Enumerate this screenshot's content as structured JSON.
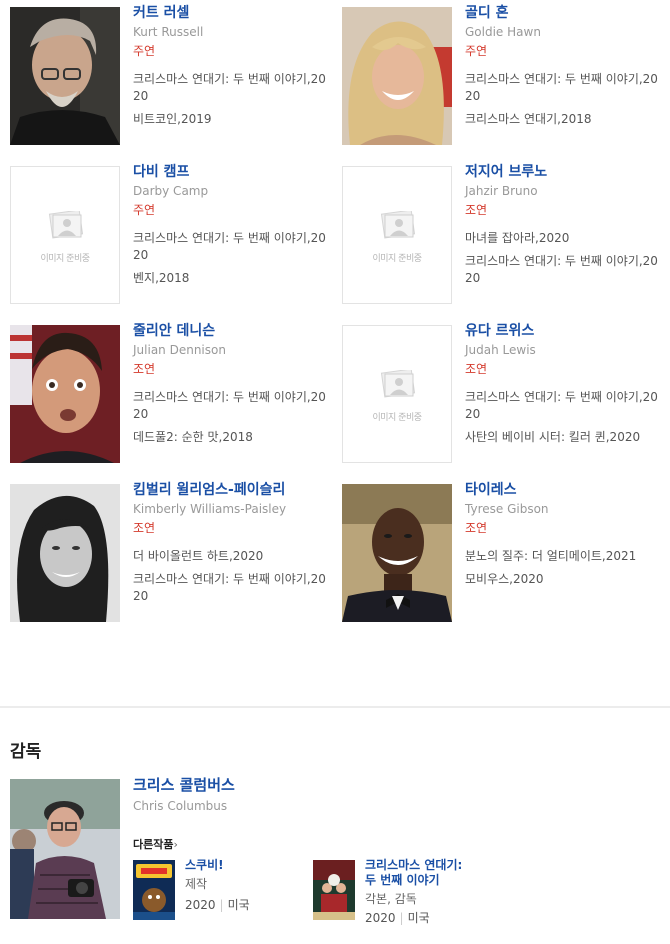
{
  "cast": [
    {
      "name_ko": "커트 러셀",
      "name_en": "Kurt Russell",
      "role": "주연",
      "works": [
        "크리스마스 연대기: 두 번째 이야기,2020",
        "비트코인,2019"
      ],
      "has_photo": true,
      "photo_icon": "portrait-photo"
    },
    {
      "name_ko": "골디 혼",
      "name_en": "Goldie Hawn",
      "role": "주연",
      "works": [
        "크리스마스 연대기: 두 번째 이야기,2020",
        "크리스마스 연대기,2018"
      ],
      "has_photo": true,
      "photo_icon": "portrait-photo"
    },
    {
      "name_ko": "다비 캠프",
      "name_en": "Darby Camp",
      "role": "주연",
      "works": [
        "크리스마스 연대기: 두 번째 이야기,2020",
        "벤지,2018"
      ],
      "has_photo": false,
      "placeholder_text": "이미지 준비중"
    },
    {
      "name_ko": "저지어 브루노",
      "name_en": "Jahzir Bruno",
      "role": "조연",
      "works": [
        "마녀를 잡아라,2020",
        "크리스마스 연대기: 두 번째 이야기,2020"
      ],
      "has_photo": false,
      "placeholder_text": "이미지 준비중"
    },
    {
      "name_ko": "줄리안 데니슨",
      "name_en": "Julian Dennison",
      "role": "조연",
      "works": [
        "크리스마스 연대기: 두 번째 이야기,2020",
        "데드풀2: 순한 맛,2018"
      ],
      "has_photo": true,
      "photo_icon": "portrait-photo"
    },
    {
      "name_ko": "유다 르위스",
      "name_en": "Judah Lewis",
      "role": "조연",
      "works": [
        "크리스마스 연대기: 두 번째 이야기,2020",
        "사탄의 베이비 시터: 킬러 퀸,2020"
      ],
      "has_photo": false,
      "placeholder_text": "이미지 준비중"
    },
    {
      "name_ko": "킴벌리 윌리엄스-페이슬리",
      "name_en": "Kimberly Williams-Paisley",
      "role": "조연",
      "works": [
        "더 바이올런트 하트,2020",
        "크리스마스 연대기: 두 번째 이야기,2020"
      ],
      "has_photo": true,
      "photo_icon": "portrait-photo"
    },
    {
      "name_ko": "타이레스",
      "name_en": "Tyrese Gibson",
      "role": "조연",
      "works": [
        "분노의 질주: 더 얼티메이트,2021",
        "모비우스,2020"
      ],
      "has_photo": true,
      "photo_icon": "portrait-photo"
    }
  ],
  "director_section": {
    "title": "감독",
    "name_ko": "크리스 콜럼버스",
    "name_en": "Chris Columbus",
    "more_label": "다른작품",
    "films": [
      {
        "title": "스쿠비!",
        "role": "제작",
        "year": "2020",
        "country": "미국"
      },
      {
        "title": "크리스마스 연대기: 두 번째 이야기",
        "role": "각본, 감독",
        "year": "2020",
        "country": "미국"
      }
    ]
  },
  "colors": {
    "name": "#1a4fa5",
    "role": "#d43a2d"
  }
}
